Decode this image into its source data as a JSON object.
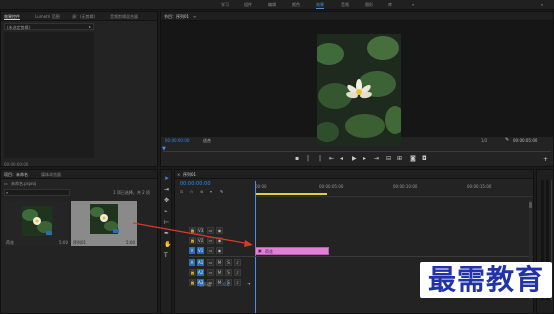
{
  "workspace_tabs": [
    "学习",
    "组件",
    "编辑",
    "颜色",
    "效果",
    "音频",
    "图形",
    "库"
  ],
  "workspace_active_index": 4,
  "source_panel": {
    "tabs": [
      "效果控件",
      "Lumetri 范围",
      "源：(无剪辑)",
      "音频剪辑混合器"
    ],
    "clip_select": "(未选定剪辑)",
    "timecode": "00:00:00:00"
  },
  "program_monitor": {
    "title": "节目：序列01",
    "timecode_current": "00:00:00:00",
    "fit_label": "适合",
    "resolution": "1/2",
    "timecode_total": "00:00:05:00"
  },
  "project_panel": {
    "tabs": [
      "项目：未命名",
      "媒体浏览器"
    ],
    "file_name": "未命名.prproj",
    "selection_info": "1 项已选择，共 2 项",
    "items": [
      {
        "name": "荷花",
        "duration": "5:00"
      },
      {
        "name": "序列01",
        "duration": "5:00"
      }
    ]
  },
  "timeline": {
    "title": "序列01",
    "timecode": "00:00:00:00",
    "ruler": [
      "00:00",
      "00:00:05:00",
      "00:00:10:00",
      "00:00:15:00"
    ],
    "video_tracks": [
      "V3",
      "V2",
      "V1"
    ],
    "audio_tracks": [
      "A1",
      "A2",
      "A3"
    ],
    "master_label": "主声道",
    "master_value": "0.0",
    "clip": {
      "name": "荷花",
      "track": "V1",
      "color": "#e27fd9"
    }
  },
  "watermark": "最需教育",
  "colors": {
    "accent": "#2d8ceb",
    "clip": "#e27fd9",
    "playhead": "#4b8fe8",
    "arrow": "#d9382b"
  }
}
